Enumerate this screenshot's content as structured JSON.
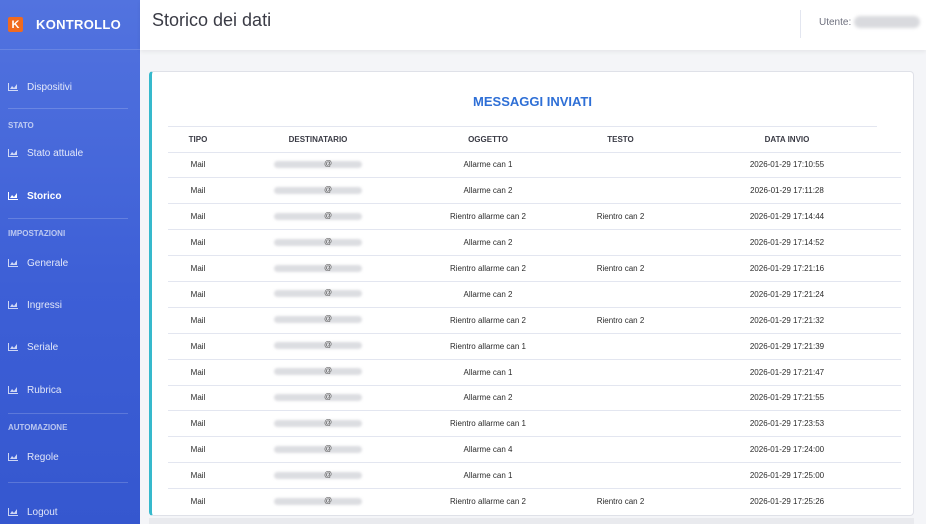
{
  "brand": {
    "logo_letter": "K",
    "name": "KONTROLLO",
    "accent": "#f06a1f"
  },
  "sidebar": {
    "sections": {
      "stato": "STATO",
      "impostazioni": "IMPOSTAZIONI",
      "automazione": "AUTOMAZIONE"
    },
    "items": [
      {
        "label": "Dispositivi",
        "icon": "chart-area-icon"
      },
      {
        "label": "Stato attuale",
        "icon": "chart-area-icon"
      },
      {
        "label": "Storico",
        "icon": "chart-area-icon",
        "active": true
      },
      {
        "label": "Generale",
        "icon": "chart-area-icon"
      },
      {
        "label": "Ingressi",
        "icon": "chart-area-icon"
      },
      {
        "label": "Seriale",
        "icon": "chart-area-icon"
      },
      {
        "label": "Rubrica",
        "icon": "chart-area-icon"
      },
      {
        "label": "Regole",
        "icon": "chart-area-icon"
      },
      {
        "label": "Logout",
        "icon": "chart-area-icon"
      }
    ]
  },
  "header": {
    "title": "Storico dei dati",
    "user_label": "Utente:"
  },
  "card": {
    "title": "MESSAGGI INVIATI",
    "columns": [
      "TIPO",
      "DESTINATARIO",
      "OGGETTO",
      "TESTO",
      "DATA INVIO"
    ],
    "rows": [
      {
        "tipo": "Mail",
        "dest": "@",
        "oggetto": "Allarme can 1",
        "testo": "",
        "data": "2026-01-29 17:10:55"
      },
      {
        "tipo": "Mail",
        "dest": "@",
        "oggetto": "Allarme can 2",
        "testo": "",
        "data": "2026-01-29 17:11:28"
      },
      {
        "tipo": "Mail",
        "dest": "@",
        "oggetto": "Rientro allarme can 2",
        "testo": "Rientro can 2",
        "data": "2026-01-29 17:14:44"
      },
      {
        "tipo": "Mail",
        "dest": "@",
        "oggetto": "Allarme can 2",
        "testo": "",
        "data": "2026-01-29 17:14:52"
      },
      {
        "tipo": "Mail",
        "dest": "@",
        "oggetto": "Rientro allarme can 2",
        "testo": "Rientro can 2",
        "data": "2026-01-29 17:21:16"
      },
      {
        "tipo": "Mail",
        "dest": "@",
        "oggetto": "Allarme can 2",
        "testo": "",
        "data": "2026-01-29 17:21:24"
      },
      {
        "tipo": "Mail",
        "dest": "@",
        "oggetto": "Rientro allarme can 2",
        "testo": "Rientro can 2",
        "data": "2026-01-29 17:21:32"
      },
      {
        "tipo": "Mail",
        "dest": "@",
        "oggetto": "Rientro allarme can 1",
        "testo": "",
        "data": "2026-01-29 17:21:39"
      },
      {
        "tipo": "Mail",
        "dest": "@",
        "oggetto": "Allarme can 1",
        "testo": "",
        "data": "2026-01-29 17:21:47"
      },
      {
        "tipo": "Mail",
        "dest": "@",
        "oggetto": "Allarme can 2",
        "testo": "",
        "data": "2026-01-29 17:21:55"
      },
      {
        "tipo": "Mail",
        "dest": "@",
        "oggetto": "Rientro allarme can 1",
        "testo": "",
        "data": "2026-01-29 17:23:53"
      },
      {
        "tipo": "Mail",
        "dest": "@",
        "oggetto": "Allarme can 4",
        "testo": "",
        "data": "2026-01-29 17:24:00"
      },
      {
        "tipo": "Mail",
        "dest": "@",
        "oggetto": "Allarme can 1",
        "testo": "",
        "data": "2026-01-29 17:25:00"
      },
      {
        "tipo": "Mail",
        "dest": "@",
        "oggetto": "Rientro allarme can 2",
        "testo": "Rientro can 2",
        "data": "2026-01-29 17:25:26"
      }
    ]
  },
  "colors": {
    "sidebar": "#4466d9",
    "title": "#2e6fd6",
    "card_border": "#36b9cc"
  }
}
